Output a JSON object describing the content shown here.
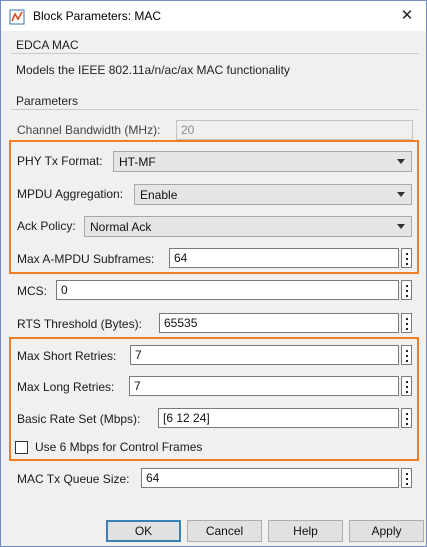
{
  "window": {
    "title": "Block Parameters: MAC"
  },
  "block": {
    "group_label": "EDCA MAC",
    "description": "Models the IEEE 802.11a/n/ac/ax MAC functionality"
  },
  "parameters": {
    "group_label": "Parameters",
    "channel_bandwidth": {
      "label": "Channel Bandwidth (MHz):",
      "value": "20"
    },
    "phy_tx_format": {
      "label": "PHY Tx Format:",
      "value": "HT-MF"
    },
    "mpdu_aggregation": {
      "label": "MPDU Aggregation:",
      "value": "Enable"
    },
    "ack_policy": {
      "label": "Ack Policy:",
      "value": "Normal Ack"
    },
    "max_ampdu_subframes": {
      "label": "Max A-MPDU Subframes:",
      "value": "64"
    },
    "mcs": {
      "label": "MCS:",
      "value": "0"
    },
    "rts_threshold": {
      "label": "RTS Threshold (Bytes):",
      "value": "65535"
    },
    "max_short_retries": {
      "label": "Max Short Retries:",
      "value": "7"
    },
    "max_long_retries": {
      "label": "Max Long Retries:",
      "value": "7"
    },
    "basic_rate_set": {
      "label": "Basic Rate Set (Mbps):",
      "value": "[6 12 24]"
    },
    "use_6mbps_control": {
      "label": "Use 6 Mbps for Control Frames",
      "checked": false
    },
    "mac_tx_queue_size": {
      "label": "MAC Tx Queue Size:",
      "value": "64"
    }
  },
  "buttons": {
    "ok": "OK",
    "cancel": "Cancel",
    "help": "Help",
    "apply": "Apply"
  },
  "colors": {
    "highlight": "#f07f24",
    "window_border": "#6e8fbf"
  }
}
